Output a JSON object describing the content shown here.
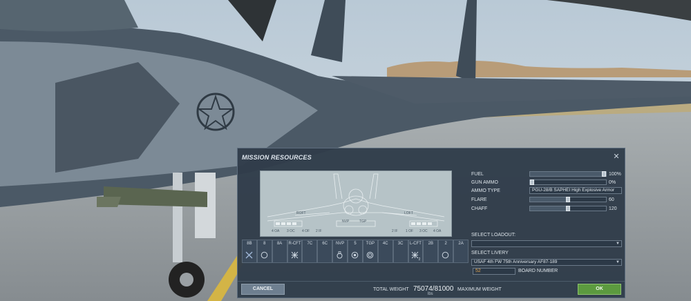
{
  "dialog": {
    "title": "MISSION RESOURCES",
    "close_icon": "close-icon"
  },
  "schematic": {
    "labels": {
      "roft": "ROFT",
      "loft": "LOFT",
      "nvp": "NVP",
      "tgp": "TGP",
      "r_outer": "4 OA",
      "r_mid": "3 OC",
      "r_inner": "4 OF",
      "r_i2": "2 IF",
      "l_outer": "1 OF",
      "l_mid": "3 OC",
      "l_inner": "4 OA",
      "l_i2": "2 IF"
    }
  },
  "stations": [
    {
      "label": "8B",
      "icon": "x-icon",
      "count": ""
    },
    {
      "label": "8",
      "icon": "circle-icon",
      "count": ""
    },
    {
      "label": "8A",
      "icon": "",
      "count": ""
    },
    {
      "label": "R-CFT",
      "icon": "cluster-icon",
      "count": ""
    },
    {
      "label": "7C",
      "icon": "",
      "count": ""
    },
    {
      "label": "6C",
      "icon": "",
      "count": ""
    },
    {
      "label": "NVP",
      "icon": "pod-icon",
      "count": ""
    },
    {
      "label": "5",
      "icon": "tank-icon",
      "count": ""
    },
    {
      "label": "TGP",
      "icon": "gear-icon",
      "count": ""
    },
    {
      "label": "4C",
      "icon": "",
      "count": ""
    },
    {
      "label": "3C",
      "icon": "",
      "count": ""
    },
    {
      "label": "L-CFT",
      "icon": "cluster-icon",
      "count": "2"
    },
    {
      "label": "2B",
      "icon": "",
      "count": ""
    },
    {
      "label": "2",
      "icon": "circle-icon",
      "count": ""
    },
    {
      "label": "2A",
      "icon": "",
      "count": ""
    }
  ],
  "resources": {
    "fuel": {
      "label": "FUEL",
      "value": "100%",
      "fraction": 1.0
    },
    "gun_ammo": {
      "label": "GUN AMMO",
      "value": "0%",
      "fraction": 0.0
    },
    "ammo_type": {
      "label": "AMMO TYPE",
      "value": "PGU-28/B SAPHEI High Explosive Armor"
    },
    "flare": {
      "label": "FLARE",
      "value": "60",
      "fraction": 0.5
    },
    "chaff": {
      "label": "CHAFF",
      "value": "120",
      "fraction": 0.5
    }
  },
  "loadout": {
    "label": "SELECT LOADOUT:",
    "value": ""
  },
  "livery": {
    "label": "SELECT LIVERY",
    "value": "USAF 4th FW 75th Anniversary AF87-189"
  },
  "board": {
    "label": "BOARD NUMBER",
    "value": "52"
  },
  "footer": {
    "cancel_label": "CANCEL",
    "ok_label": "OK",
    "total_weight_label": "TOTAL WEIGHT",
    "total_weight_value": "75074/81000",
    "weight_unit": "lbs",
    "max_weight_label": "MAXIMUM WEIGHT"
  }
}
